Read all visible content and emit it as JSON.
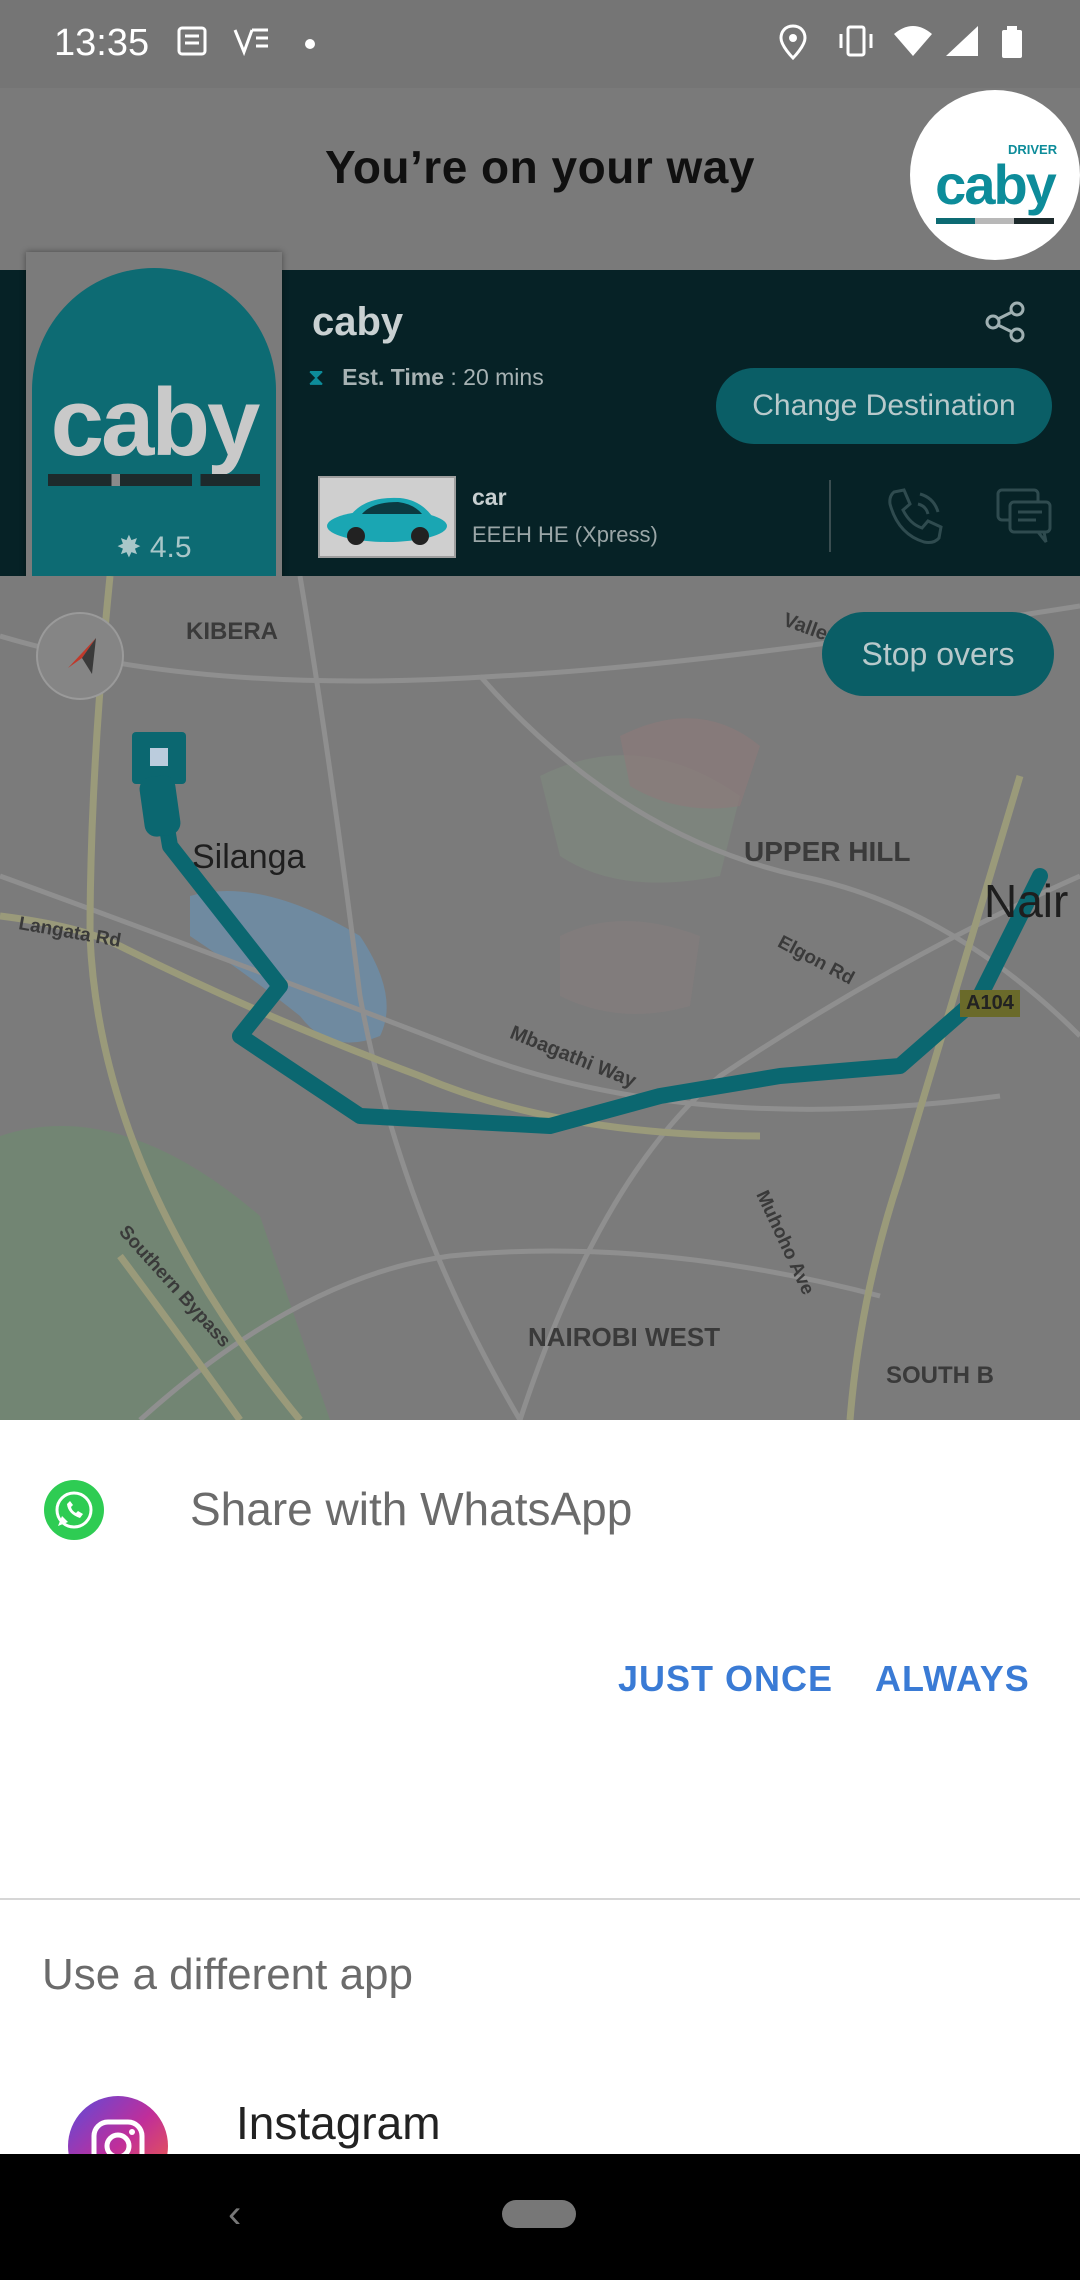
{
  "status_bar": {
    "time": "13:35",
    "icons": [
      "news-icon",
      "vpn-icon",
      "dot-icon",
      "location-icon",
      "vibrate-icon",
      "wifi-icon",
      "signal-icon",
      "battery-icon"
    ]
  },
  "header": {
    "title": "You’re on your way",
    "logo_word": "caby",
    "logo_tag": "DRIVER"
  },
  "trip": {
    "driver_logo_word": "caby",
    "rating": "4.5",
    "driver_name": "caby",
    "est_label": "Est. Time",
    "est_value": ": 20 mins",
    "change_destination": "Change Destination",
    "car_type": "car",
    "car_plate": "EEEH HE (Xpress)"
  },
  "map": {
    "stop_overs": "Stop overs",
    "labels": {
      "kibera": "KIBERA",
      "silanga": "Silanga",
      "upper_hill": "UPPER HILL",
      "nairobi": "Nair",
      "langata_rd": "Langata Rd",
      "elgon_rd": "Elgon Rd",
      "a104": "A104",
      "mbagathi_way": "Mbagathi Way",
      "valley": "Valley",
      "southern_bypass": "Southern Bypass",
      "muhoho_ave": "Muhoho Ave",
      "nairobi_west": "NAIROBI WEST",
      "south_b": "SOUTH B"
    },
    "colors": {
      "route": "#0b6770",
      "water": "#6f8aa0",
      "park": "#6f8f6f"
    }
  },
  "sheet": {
    "share_title": "Share with WhatsApp",
    "just_once": "JUST ONCE",
    "always": "ALWAYS",
    "different_app": "Use a different app",
    "apps": [
      {
        "name": "Instagram"
      }
    ]
  },
  "colors": {
    "accent": "#3a7bd5",
    "brand": "#0d6b73"
  }
}
